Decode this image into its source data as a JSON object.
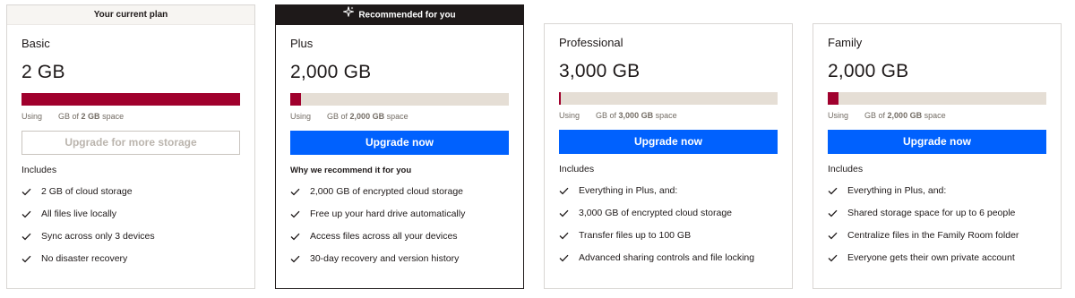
{
  "plans": [
    {
      "banner": "Your current plan",
      "name": "Basic",
      "size": "2 GB",
      "usage_pre": "Using",
      "usage_mid": "GB of",
      "usage_total": "2 GB",
      "usage_post": "space",
      "usage_fraction": 1.0,
      "button": "Upgrade for more storage",
      "includes_heading": "Includes",
      "features": [
        "2 GB of cloud storage",
        "All files live locally",
        "Sync across only 3 devices",
        "No disaster recovery"
      ]
    },
    {
      "banner": "Recommended for you",
      "name": "Plus",
      "size": "2,000 GB",
      "usage_pre": "Using",
      "usage_mid": "GB of",
      "usage_total": "2,000 GB",
      "usage_post": "space",
      "usage_fraction": 0.05,
      "button": "Upgrade now",
      "includes_heading": "Why we recommend it for you",
      "features": [
        "2,000 GB of encrypted cloud storage",
        "Free up your hard drive automatically",
        "Access files across all your devices",
        "30-day recovery and version history"
      ]
    },
    {
      "name": "Professional",
      "size": "3,000 GB",
      "usage_pre": "Using",
      "usage_mid": "GB of",
      "usage_total": "3,000 GB",
      "usage_post": "space",
      "usage_fraction": 0.01,
      "button": "Upgrade now",
      "includes_heading": "Includes",
      "features": [
        "Everything in Plus, and:",
        "3,000 GB of encrypted cloud storage",
        "Transfer files up to 100 GB",
        "Advanced sharing controls and file locking"
      ]
    },
    {
      "name": "Family",
      "size": "2,000 GB",
      "usage_pre": "Using",
      "usage_mid": "GB of",
      "usage_total": "2,000 GB",
      "usage_post": "space",
      "usage_fraction": 0.05,
      "button": "Upgrade now",
      "includes_heading": "Includes",
      "features": [
        "Everything in Plus, and:",
        "Shared storage space for up to 6 people",
        "Centralize files in the Family Room folder",
        "Everyone gets their own private account"
      ]
    }
  ],
  "colors": {
    "accent_blue": "#0061fe",
    "usage_fill": "#a0002d",
    "bar_track": "#e5ded5"
  },
  "icons": {
    "banner_recommended": "sparkle-icon",
    "feature": "checkmark-icon"
  }
}
